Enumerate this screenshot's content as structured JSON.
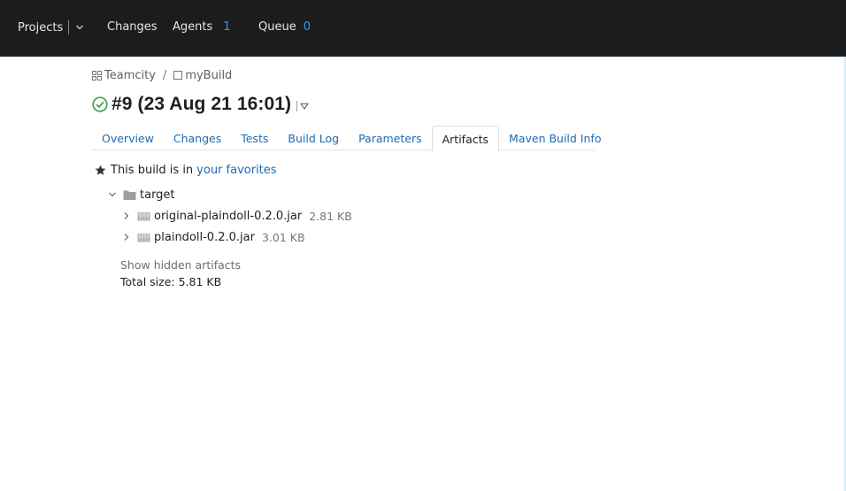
{
  "topbar": {
    "projects_label": "Projects",
    "changes_label": "Changes",
    "agents_label": "Agents",
    "agents_count": "1",
    "queue_label": "Queue",
    "queue_count": "0"
  },
  "breadcrumb": {
    "project": "Teamcity",
    "separator": "/",
    "build_config": "myBuild"
  },
  "build": {
    "title": "#9 (23 Aug 21 16:01)",
    "status": "success"
  },
  "tabs": [
    {
      "label": "Overview"
    },
    {
      "label": "Changes"
    },
    {
      "label": "Tests"
    },
    {
      "label": "Build Log"
    },
    {
      "label": "Parameters"
    },
    {
      "label": "Artifacts",
      "active": true
    },
    {
      "label": "Maven Build Info"
    }
  ],
  "favorites": {
    "text": "This build is in",
    "link": "your favorites"
  },
  "artifacts": {
    "folder": "target",
    "files": [
      {
        "name": "original-plaindoll-0.2.0.jar",
        "size": "2.81 KB"
      },
      {
        "name": "plaindoll-0.2.0.jar",
        "size": "3.01 KB"
      }
    ],
    "show_hidden_label": "Show hidden artifacts",
    "total_size": "Total size: 5.81 KB"
  },
  "colors": {
    "topbar_bg": "#1b1c1e",
    "link": "#1e6ab0",
    "count": "#2f9bff",
    "success": "#3aa653"
  }
}
